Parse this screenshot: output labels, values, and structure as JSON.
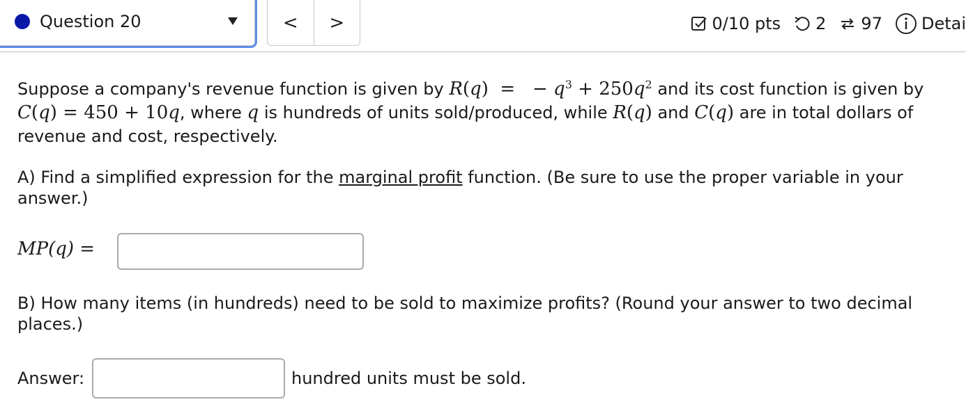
{
  "header": {
    "question_label": "Question 20",
    "nav_prev": "<",
    "nav_next": ">"
  },
  "status": {
    "score": "0/10 pts",
    "retries": "2",
    "submissions": "97",
    "details": "Detai"
  },
  "question": {
    "p1": {
      "t1": "Suppose a company's revenue function is given by ",
      "R": "R",
      "q": "q",
      "neg": "−",
      "exp3": "3",
      "plus": "+",
      "coef250": "250",
      "exp2": "2",
      "t2": " and its cost function is given by",
      "C": "C",
      "eq": "=",
      "c450": "450",
      "c10": "10",
      "t3": ", where ",
      "t4": " is hundreds of units sold/produced, while ",
      "t5": " and ",
      "t6": " are in total dollars of",
      "t7": "revenue and cost, respectively."
    },
    "partA": {
      "prefix": "A) Find a simplified expression for the ",
      "underlined": "marginal profit",
      "suffix": " function. (Be sure to use the proper variable in your answer.)"
    },
    "mp_label": "MP(q) =",
    "partB": "B) How many items (in hundreds) need to be sold to maximize profits? (Round your answer to two decimal places.)",
    "answer_label": "Answer:",
    "answer_suffix": "hundred units must be sold."
  },
  "colors": {
    "question_dot": "#0a18a8",
    "focus_ring": "#5e8ee6"
  }
}
